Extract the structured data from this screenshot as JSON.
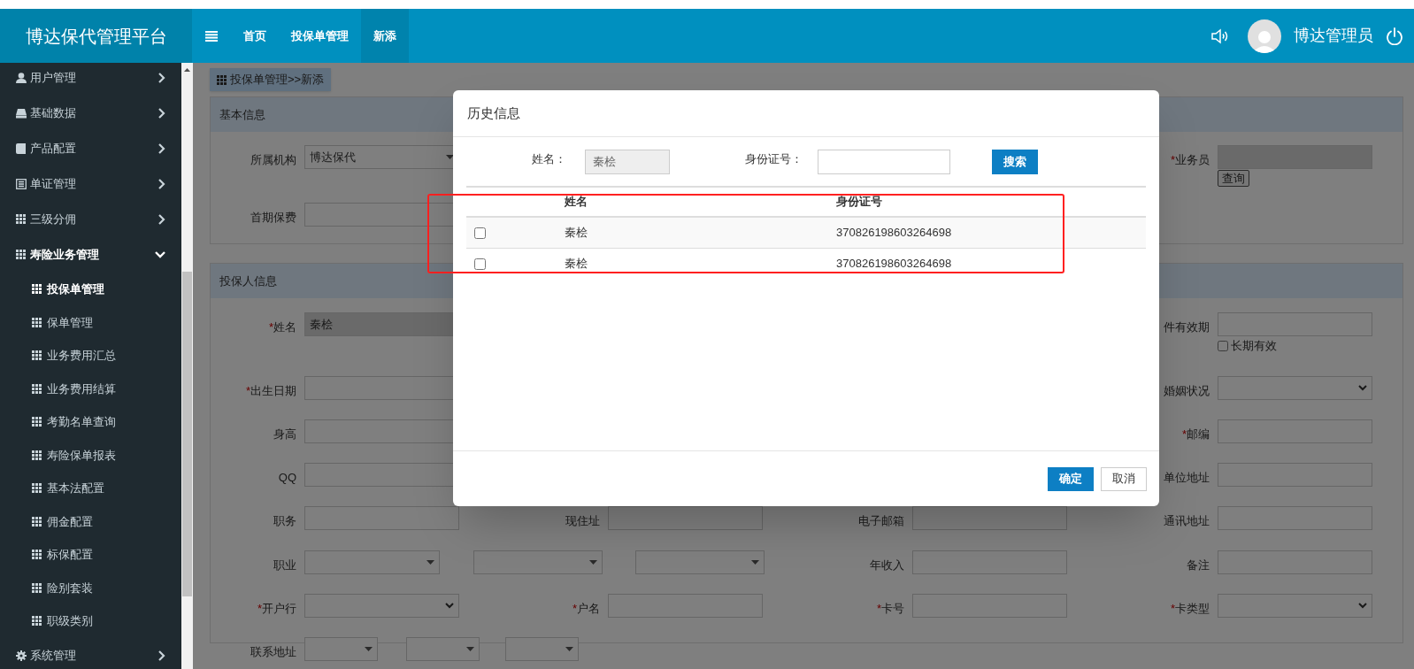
{
  "header": {
    "logo": "博达保代管理平台",
    "nav": [
      {
        "kind": "menu"
      },
      {
        "label": "首页",
        "selected": false
      },
      {
        "label": "投保单管理",
        "selected": false
      },
      {
        "label": "新添",
        "selected": true
      }
    ],
    "user": "博达管理员"
  },
  "sidebar": {
    "items": [
      {
        "label": "用户管理",
        "kind": "user",
        "expanded": false
      },
      {
        "label": "基础数据",
        "kind": "drive",
        "expanded": false
      },
      {
        "label": "产品配置",
        "kind": "book",
        "expanded": false
      },
      {
        "label": "单证管理",
        "kind": "list",
        "expanded": false
      },
      {
        "label": "三级分佣",
        "kind": "grid",
        "expanded": false
      },
      {
        "label": "寿险业务管理",
        "kind": "grid",
        "expanded": true,
        "children": [
          {
            "label": "投保单管理",
            "selected": true
          },
          {
            "label": "保单管理",
            "selected": false
          },
          {
            "label": "业务费用汇总",
            "selected": false
          },
          {
            "label": "业务费用结算",
            "selected": false
          },
          {
            "label": "考勤名单查询",
            "selected": false
          },
          {
            "label": "寿险保单报表",
            "selected": false
          },
          {
            "label": "基本法配置",
            "selected": false
          },
          {
            "label": "佣金配置",
            "selected": false
          },
          {
            "label": "标保配置",
            "selected": false
          },
          {
            "label": "险别套装",
            "selected": false
          },
          {
            "label": "职级类别",
            "selected": false
          }
        ]
      },
      {
        "label": "系统管理",
        "kind": "gear",
        "expanded": false
      }
    ]
  },
  "breadcrumb": "投保单管理>>新添",
  "panels": [
    {
      "title": "基本信息",
      "rows": [
        {
          "cells": [
            {
              "label": "所属机构",
              "controls": [
                {
                  "kind": "dropdown",
                  "value": "博达保代"
                }
              ]
            },
            {
              "marker": "*",
              "label": "业务员",
              "controls": [
                {
                  "kind": "input",
                  "disabled": true
                }
              ],
              "button": "查询"
            }
          ]
        },
        {
          "cells": [
            {
              "label": "首期保费",
              "controls": [
                {
                  "kind": "input",
                  "disabled": false
                }
              ]
            }
          ]
        }
      ]
    },
    {
      "title": "投保人信息",
      "rows": [
        {
          "cells": [
            {
              "marker": "*",
              "label": "姓名",
              "controls": [
                {
                  "kind": "input",
                  "value": "秦桧",
                  "disabled": true
                }
              ]
            },
            {
              "label": "件有效期",
              "controls": [
                {
                  "kind": "input",
                  "disabled": false
                }
              ],
              "checkbox": {
                "label": "长期有效",
                "checked": false
              }
            }
          ]
        },
        {
          "cells": [
            {
              "marker": "*",
              "label": "出生日期",
              "controls": [
                {
                  "kind": "input",
                  "disabled": false
                }
              ]
            },
            {
              "label": "婚姻状况",
              "controls": [
                {
                  "kind": "select"
                }
              ]
            }
          ]
        },
        {
          "cells": [
            {
              "label": "身高",
              "controls": [
                {
                  "kind": "input",
                  "disabled": false
                }
              ]
            },
            {
              "marker": "*",
              "label": "邮编",
              "controls": [
                {
                  "kind": "input",
                  "disabled": false
                }
              ]
            }
          ]
        },
        {
          "cells": [
            {
              "label": "QQ",
              "controls": [
                {
                  "kind": "input",
                  "disabled": false
                }
              ]
            },
            {
              "label": "单位地址",
              "controls": [
                {
                  "kind": "input",
                  "disabled": false
                }
              ]
            }
          ]
        },
        {
          "cells": [
            {
              "label": "职务",
              "controls": [
                {
                  "kind": "input",
                  "disabled": false
                }
              ]
            },
            {
              "label": "现住址",
              "controls": [
                {
                  "kind": "input",
                  "disabled": false
                }
              ]
            },
            {
              "label": "电子邮箱",
              "controls": [
                {
                  "kind": "input",
                  "disabled": false
                }
              ]
            },
            {
              "label": "通讯地址",
              "controls": [
                {
                  "kind": "input",
                  "disabled": false
                }
              ]
            }
          ]
        },
        {
          "cells": [
            {
              "label": "职业",
              "controls": [
                {
                  "kind": "dropdown"
                },
                {
                  "kind": "dropdown"
                }
              ]
            },
            {
              "controls": [
                {
                  "kind": "dropdown"
                }
              ]
            },
            {
              "label": "年收入",
              "controls": [
                {
                  "kind": "input",
                  "disabled": false
                }
              ]
            },
            {
              "label": "备注",
              "controls": [
                {
                  "kind": "input",
                  "disabled": false
                }
              ]
            }
          ]
        },
        {
          "cells": [
            {
              "marker": "*",
              "label": "开户行",
              "controls": [
                {
                  "kind": "select"
                }
              ]
            },
            {
              "marker": "*",
              "label": "户名",
              "controls": [
                {
                  "kind": "input",
                  "disabled": false
                }
              ]
            },
            {
              "marker": "*",
              "label": "卡号",
              "controls": [
                {
                  "kind": "input",
                  "disabled": false
                }
              ]
            },
            {
              "marker": "*",
              "label": "卡类型",
              "controls": [
                {
                  "kind": "select"
                }
              ]
            }
          ]
        },
        {
          "cells": [
            {
              "label": "联系地址",
              "controls": [
                {
                  "kind": "dropdown"
                },
                {
                  "kind": "dropdown"
                },
                {
                  "kind": "dropdown"
                }
              ]
            }
          ]
        }
      ]
    }
  ],
  "modal": {
    "title": "历史信息",
    "name_label": "姓名：",
    "name_value": "秦桧",
    "id_label": "身份证号：",
    "search_button": "搜索",
    "table": {
      "columns": [
        "姓名",
        "身份证号"
      ],
      "rows": [
        {
          "checked": false,
          "cells": [
            "秦桧",
            "370826198603264698"
          ]
        },
        {
          "checked": false,
          "cells": [
            "秦桧",
            "370826198603264698"
          ]
        }
      ]
    },
    "buttons": [
      {
        "label": "确定",
        "kind": "primary"
      },
      {
        "label": "取消",
        "kind": "default"
      }
    ]
  }
}
